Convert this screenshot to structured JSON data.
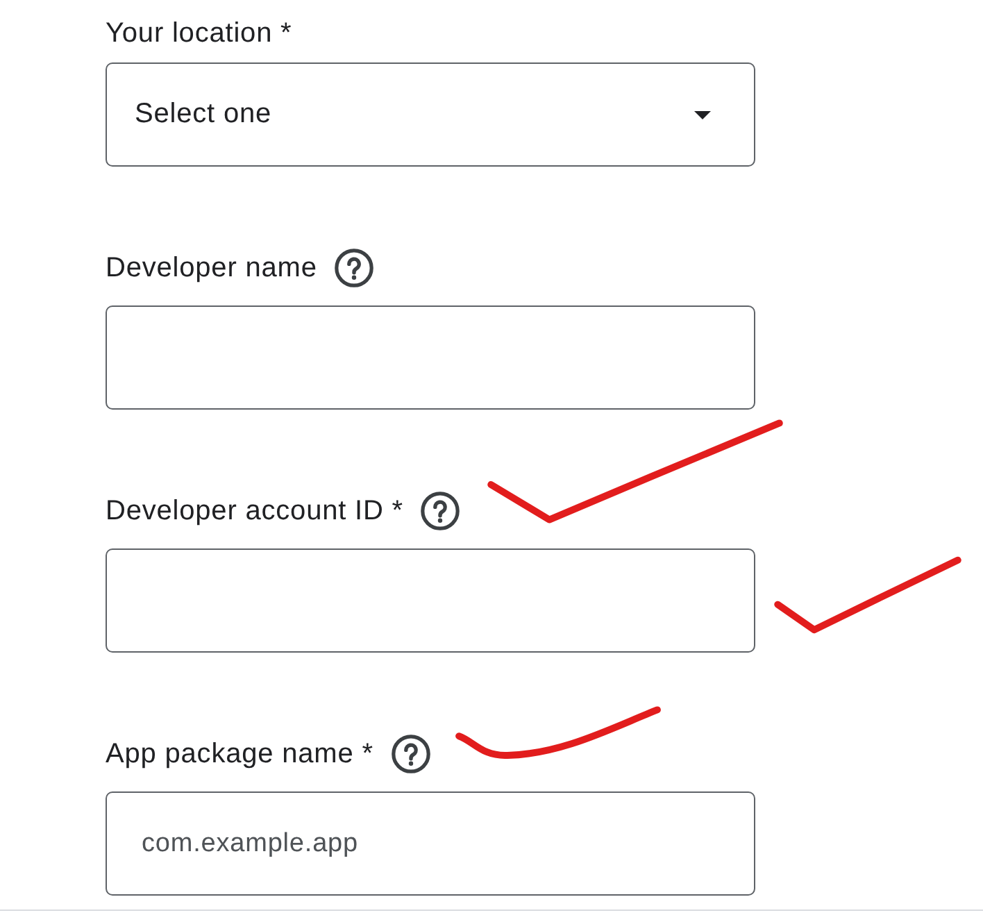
{
  "fields": [
    {
      "kind": "select",
      "label": "Your location *",
      "help": false,
      "value": "Select one"
    },
    {
      "kind": "text",
      "label": "Developer name",
      "help": true
    },
    {
      "kind": "text",
      "label": "Developer account ID *",
      "help": true,
      "label_mark": {
        "kind": "tick"
      },
      "input_mark": {
        "kind": "tick"
      }
    },
    {
      "kind": "text",
      "label": "App package name *",
      "help": true,
      "placeholder": "com.example.app",
      "label_mark": {
        "kind": "swoosh"
      }
    }
  ]
}
